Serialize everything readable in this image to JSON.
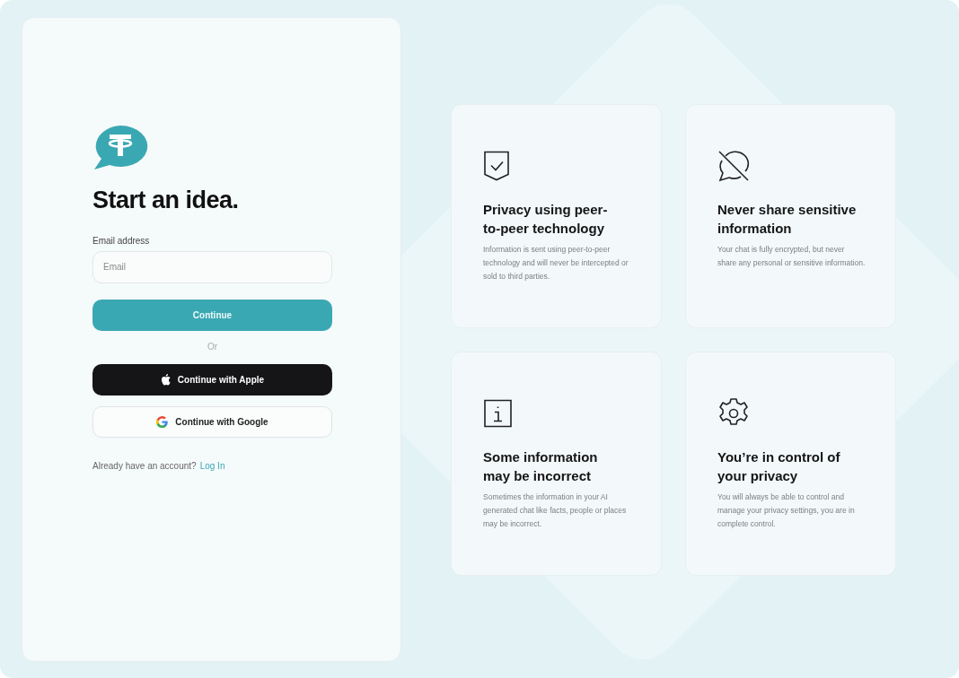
{
  "signup": {
    "title": "Start an idea.",
    "email_label": "Email address",
    "email_placeholder": "Email",
    "continue_button": "Continue",
    "divider": "Or",
    "social_buttons": [
      {
        "kind": "apple",
        "label": "Continue with Apple"
      },
      {
        "kind": "google",
        "label": "Continue with Google"
      }
    ],
    "login_prompt": "Already have an account?",
    "login_link": "Log In"
  },
  "features": [
    {
      "kind": "shield",
      "title": "Privacy using peer-to-peer technology",
      "text": "Information is sent using peer-to-peer technology and will never be intercepted or sold to third parties."
    },
    {
      "kind": "no-chat",
      "title": "Never share sensitive information",
      "text": "Your chat is fully encrypted, but never share any personal or sensitive information."
    },
    {
      "kind": "info",
      "title": "Some information may be incorrect",
      "text": "Sometimes the information in your AI generated chat like facts, people or places may be incorrect."
    },
    {
      "kind": "gear",
      "title": "You’re in control of your privacy",
      "text": "You will always be able to control and manage your privacy settings, you are in complete control."
    }
  ]
}
